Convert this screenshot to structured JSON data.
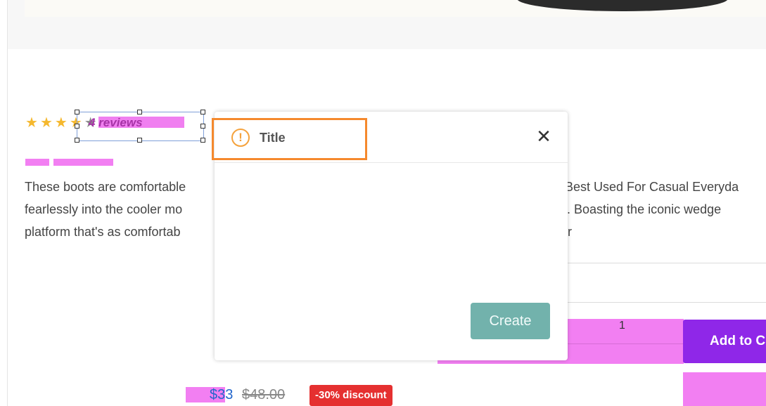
{
  "product": {
    "rating": {
      "value": 4,
      "max": 5
    },
    "reviews_label": "4 reviews",
    "description_lines": [
      "These boots are comfortable",
      "fearlessly into the cooler mo",
      "platform that's as comfortab"
    ],
    "description_lines_right": [
      "Best Used For Casual Everyda",
      "t. Boasting the iconic wedge",
      "r"
    ],
    "quantity": "1",
    "add_to_cart_label": "Add to C",
    "price_new": "$33",
    "price_old": "$48.00",
    "discount_label": "-30% discount"
  },
  "dialog": {
    "title": "Title",
    "warning_icon": "exclamation-circle-icon",
    "close_symbol": "✕",
    "create_label": "Create"
  },
  "colors": {
    "star": "#f5b82e",
    "accent_purple": "#8f27e8",
    "highlight_pink": "#f27ff2",
    "discount_red": "#e53030",
    "create_teal": "#72b2ac",
    "focus_orange": "#f5892d"
  }
}
